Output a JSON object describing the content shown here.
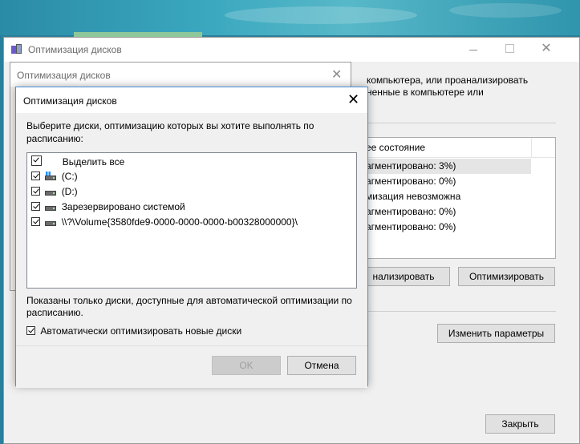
{
  "main_window": {
    "title": "Оптимизация дисков",
    "text_line1": "компьютера, или проанализировать",
    "text_line2": "ненные в компьютере или",
    "column_header": "ее состояние",
    "rows": [
      "агментировано: 3%)",
      "агментировано: 0%)",
      "мизация невозможна",
      "агментировано: 0%)",
      "агментировано: 0%)"
    ],
    "analyze_button": "нализировать",
    "optimize_button": "Оптимизировать",
    "change_settings_button": "Изменить параметры",
    "close_button": "Закрыть"
  },
  "middle_dialog": {
    "title": "Оптимизация дисков"
  },
  "front_dialog": {
    "title": "Оптимизация дисков",
    "instruction": "Выберите диски, оптимизацию которых вы хотите выполнять по расписанию:",
    "items": [
      {
        "label": "Выделить все",
        "checked": true,
        "icon": "none"
      },
      {
        "label": "(C:)",
        "checked": true,
        "icon": "system-drive-icon"
      },
      {
        "label": "(D:)",
        "checked": true,
        "icon": "drive-icon"
      },
      {
        "label": "Зарезервировано системой",
        "checked": true,
        "icon": "drive-icon"
      },
      {
        "label": "\\\\?\\Volume{3580fde9-0000-0000-0000-b00328000000}\\",
        "checked": true,
        "icon": "drive-icon"
      }
    ],
    "note": "Показаны только диски, доступные для автоматической оптимизации по расписанию.",
    "auto_optimize_label": "Автоматически оптимизировать новые диски",
    "auto_optimize_checked": true,
    "ok_button": "OK",
    "cancel_button": "Отмена"
  }
}
